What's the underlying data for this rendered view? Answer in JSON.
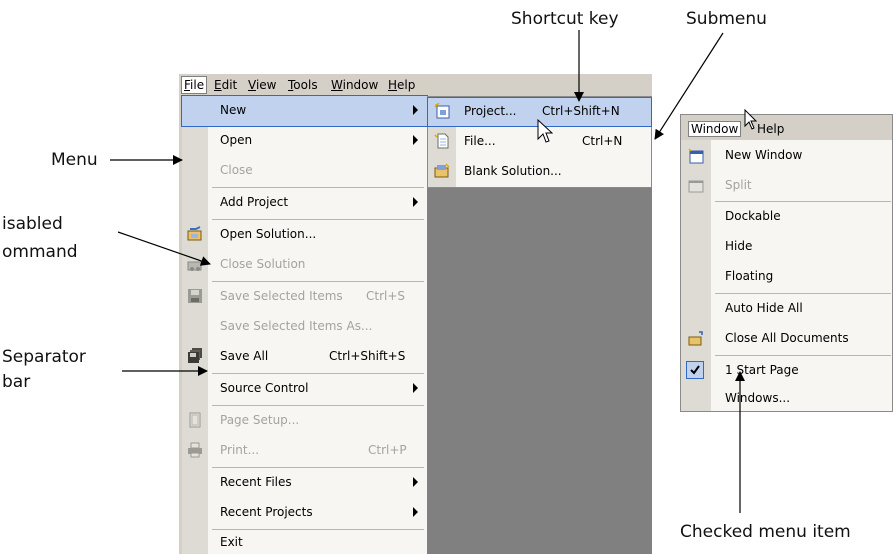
{
  "menubar": {
    "items": [
      {
        "label": "File",
        "mnemonic": "F",
        "rest": "ile"
      },
      {
        "label": "Edit",
        "mnemonic": "E",
        "rest": "dit"
      },
      {
        "label": "View",
        "mnemonic": "V",
        "rest": "iew"
      },
      {
        "label": "Tools",
        "mnemonic": "T",
        "rest": "ools"
      },
      {
        "label": "Window",
        "mnemonic": "W",
        "rest": "indow"
      },
      {
        "label": "Help",
        "mnemonic": "H",
        "rest": "elp"
      }
    ]
  },
  "file_menu": {
    "items": [
      {
        "label": "New",
        "shortcut": "",
        "submenu": true,
        "disabled": false,
        "highlighted": true,
        "icon": ""
      },
      {
        "label": "Open",
        "shortcut": "",
        "submenu": true,
        "disabled": false,
        "icon": ""
      },
      {
        "label": "Close",
        "shortcut": "",
        "submenu": false,
        "disabled": true,
        "icon": ""
      },
      {
        "label": "Add Project",
        "shortcut": "",
        "submenu": true,
        "disabled": false,
        "icon": ""
      },
      {
        "label": "Open Solution...",
        "shortcut": "",
        "submenu": false,
        "disabled": false,
        "icon": "open-solution-icon"
      },
      {
        "label": "Close Solution",
        "shortcut": "",
        "submenu": false,
        "disabled": true,
        "icon": "close-solution-icon"
      },
      {
        "label": "Save Selected Items",
        "shortcut": "Ctrl+S",
        "submenu": false,
        "disabled": true,
        "icon": "save-icon"
      },
      {
        "label": "Save Selected Items As...",
        "shortcut": "",
        "submenu": false,
        "disabled": true,
        "icon": ""
      },
      {
        "label": "Save All",
        "shortcut": "Ctrl+Shift+S",
        "submenu": false,
        "disabled": false,
        "icon": "save-all-icon"
      },
      {
        "label": "Source Control",
        "shortcut": "",
        "submenu": true,
        "disabled": false,
        "icon": ""
      },
      {
        "label": "Page Setup...",
        "shortcut": "",
        "submenu": false,
        "disabled": true,
        "icon": "page-setup-icon"
      },
      {
        "label": "Print...",
        "shortcut": "Ctrl+P",
        "submenu": false,
        "disabled": true,
        "icon": "print-icon"
      },
      {
        "label": "Recent Files",
        "shortcut": "",
        "submenu": true,
        "disabled": false,
        "icon": ""
      },
      {
        "label": "Recent Projects",
        "shortcut": "",
        "submenu": true,
        "disabled": false,
        "icon": ""
      },
      {
        "label": "Exit",
        "shortcut": "",
        "submenu": false,
        "disabled": false,
        "icon": ""
      }
    ]
  },
  "new_submenu": {
    "items": [
      {
        "label": "Project...",
        "shortcut": "Ctrl+Shift+N",
        "highlighted": true,
        "icon": "new-project-icon"
      },
      {
        "label": "File...",
        "shortcut": "Ctrl+N",
        "icon": "new-file-icon"
      },
      {
        "label": "Blank Solution...",
        "shortcut": "",
        "icon": "blank-solution-icon"
      }
    ]
  },
  "window_menu": {
    "bar": {
      "window": "Window",
      "help": "Help"
    },
    "items": [
      {
        "label": "New Window",
        "disabled": false,
        "icon": "new-window-icon"
      },
      {
        "label": "Split",
        "disabled": true,
        "icon": "split-icon"
      },
      {
        "label": "Dockable",
        "disabled": false,
        "icon": ""
      },
      {
        "label": "Hide",
        "disabled": false,
        "icon": ""
      },
      {
        "label": "Floating",
        "disabled": false,
        "icon": ""
      },
      {
        "label": "Auto Hide All",
        "disabled": false,
        "icon": ""
      },
      {
        "label": "Close All Documents",
        "disabled": false,
        "icon": "close-all-icon"
      },
      {
        "label": "1 Start Page",
        "disabled": false,
        "checked": true,
        "icon": "check-icon"
      },
      {
        "label": "Windows...",
        "disabled": false,
        "icon": ""
      }
    ]
  },
  "annotations": {
    "shortcut_key": "Shortcut key",
    "submenu": "Submenu",
    "menu": "Menu",
    "disabled_line1": "isabled",
    "disabled_line2": "ommand",
    "separator_line1": "Separator",
    "separator_line2": "bar",
    "checked_item": "Checked menu item"
  },
  "colors": {
    "menu_bg": "#f7f6f3",
    "gutter": "#dddbd4",
    "highlight": "#c1d2ee",
    "highlight_border": "#316ac5",
    "disabled_text": "#a5a39c",
    "chrome": "#d4d0c8",
    "workspace": "#808080"
  }
}
